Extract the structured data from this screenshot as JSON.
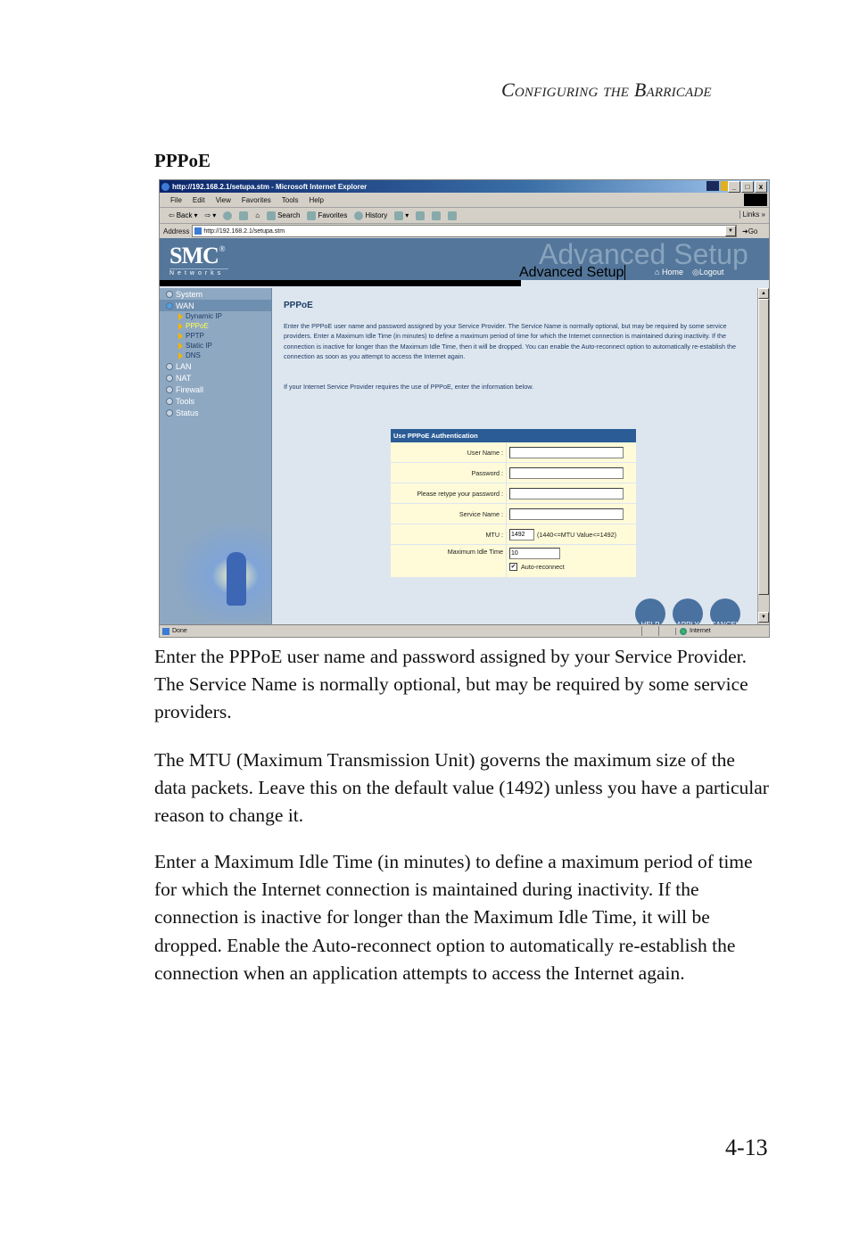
{
  "running_head": "Configuring the Barricade",
  "section_heading": "PPPoE",
  "browser": {
    "title": "http://192.168.2.1/setupa.stm - Microsoft Internet Explorer",
    "window_buttons": [
      "_",
      "□",
      "x"
    ],
    "menu": [
      "File",
      "Edit",
      "View",
      "Favorites",
      "Tools",
      "Help"
    ],
    "toolbar": {
      "back": "Back",
      "search": "Search",
      "favorites": "Favorites",
      "history": "History",
      "links": "Links"
    },
    "address": {
      "label": "Address",
      "url": "http://192.168.2.1/setupa.stm",
      "go": "Go"
    },
    "status": {
      "left": "Done",
      "zone": "Internet"
    }
  },
  "app": {
    "logo": "SMC",
    "logo_mark": "®",
    "logo_sub": "Networks",
    "banner_ghost": "Advanced Setup",
    "banner_title": "Advanced Setup",
    "nav": {
      "home": "Home",
      "logout": "Logout"
    },
    "sidebar": [
      {
        "label": "System",
        "active": false
      },
      {
        "label": "WAN",
        "active": true,
        "children": [
          {
            "label": "Dynamic IP",
            "current": false
          },
          {
            "label": "PPPoE",
            "current": true
          },
          {
            "label": "PPTP",
            "current": false
          },
          {
            "label": "Static IP",
            "current": false
          },
          {
            "label": "DNS",
            "current": false
          }
        ]
      },
      {
        "label": "LAN",
        "active": false
      },
      {
        "label": "NAT",
        "active": false
      },
      {
        "label": "Firewall",
        "active": false
      },
      {
        "label": "Tools",
        "active": false
      },
      {
        "label": "Status",
        "active": false
      }
    ],
    "page_title": "PPPoE",
    "description": "Enter the PPPoE user name and password assigned by your Service Provider. The Service Name is normally optional, but may be required by some service providers.  Enter a Maximum Idle Time (in minutes) to define a maximum period of time for which the Internet connection is maintained during inactivity.  If the connection is inactive for longer than the Maximum Idle Time, then it will be dropped.  You can enable the Auto-reconnect option to automatically re-establish the connection as soon as you attempt to access the Internet again.",
    "isp_note": "If your Internet Service Provider requires the use of PPPoE, enter the information below.",
    "form": {
      "header": "Use PPPoE Authentication",
      "user_name_label": "User Name :",
      "user_name_value": "",
      "password_label": "Password :",
      "password_value": "",
      "retype_label": "Please retype your password :",
      "retype_value": "",
      "service_name_label": "Service Name :",
      "service_name_value": "",
      "mtu_label": "MTU :",
      "mtu_value": "1492",
      "mtu_hint": "(1440<=MTU Value<=1492)",
      "idle_label": "Maximum Idle Time",
      "idle_value": "10",
      "auto_reconnect_label": "Auto-reconnect",
      "auto_reconnect_checked": true
    },
    "actions": {
      "help": "HELP",
      "apply": "APPLY",
      "cancel": "CANCEL"
    }
  },
  "body_paragraphs": [
    "Enter the PPPoE user name and password assigned by your Service Provider. The Service Name is normally optional, but may be required by some service providers.",
    "The MTU (Maximum Transmission Unit) governs the maximum size of the data packets. Leave this on the default value (1492) unless you have a particular reason to change it.",
    "Enter a Maximum Idle Time (in minutes) to define a maximum period of time for which the Internet connection is maintained during inactivity.  If the connection is inactive for longer than the Maximum Idle Time, it will be dropped.  Enable the Auto-reconnect option to automatically re-establish the connection when an application attempts to access the Internet again."
  ],
  "page_number": "4-13"
}
